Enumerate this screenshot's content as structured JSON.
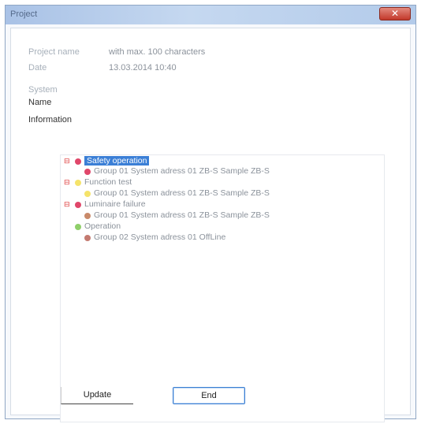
{
  "window": {
    "title": "Project",
    "close_glyph": "✕"
  },
  "fields": {
    "project_name_label": "Project name",
    "project_name_value": "with max. 100 characters",
    "date_label": "Date",
    "date_value": "13.03.2014 10:40",
    "system_label": "System",
    "name_label": "Name",
    "information_label": "Information"
  },
  "tree": [
    {
      "label": "Safety operation",
      "color": "#e0476a",
      "selected": true,
      "expander": "⊟"
    },
    {
      "label": "Group 01 System adress 01  ZB-S Sample ZB-S",
      "color": "#e0476a",
      "child": true
    },
    {
      "label": "Function test",
      "color": "#f5e36a",
      "expander": "⊟"
    },
    {
      "label": "Group 01 System adress 01  ZB-S Sample ZB-S",
      "color": "#f5e36a",
      "child": true
    },
    {
      "label": "Luminaire failure",
      "color": "#e0476a",
      "expander": "⊟"
    },
    {
      "label": "Group 01 System adress 01  ZB-S Sample ZB-S",
      "color": "#c98a6a",
      "child": true
    },
    {
      "label": "Operation",
      "color": "#8fcf6a",
      "expander": ""
    },
    {
      "label": "Group 02 System adress 01  OffLine",
      "color": "#c47a70",
      "child": true
    }
  ],
  "buttons": {
    "update_label": "Update",
    "end_label": "End"
  }
}
